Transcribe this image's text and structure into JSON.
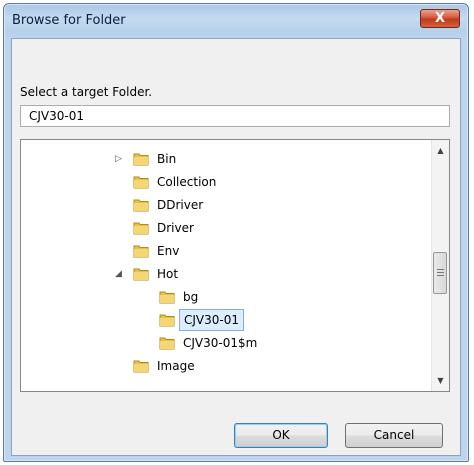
{
  "window": {
    "title": "Browse for Folder",
    "close_label": "X"
  },
  "dialog": {
    "prompt": "Select a target Folder.",
    "path_value": "CJV30-01"
  },
  "tree": {
    "items": [
      {
        "label": "Bin",
        "expander": "▷"
      },
      {
        "label": "Collection",
        "expander": ""
      },
      {
        "label": "DDriver",
        "expander": ""
      },
      {
        "label": "Driver",
        "expander": ""
      },
      {
        "label": "Env",
        "expander": ""
      },
      {
        "label": "Hot",
        "expander": "◢"
      },
      {
        "label": "bg",
        "expander": ""
      },
      {
        "label": "CJV30-01",
        "expander": "",
        "selected": true
      },
      {
        "label": "CJV30-01$m",
        "expander": ""
      },
      {
        "label": "Image",
        "expander": ""
      }
    ]
  },
  "scrollbar": {
    "up_glyph": "▲",
    "down_glyph": "▼"
  },
  "buttons": {
    "ok": "OK",
    "cancel": "Cancel"
  },
  "colors": {
    "selection": "#dceefc",
    "close": "#c03a1b",
    "folder": "#e8c14a"
  }
}
